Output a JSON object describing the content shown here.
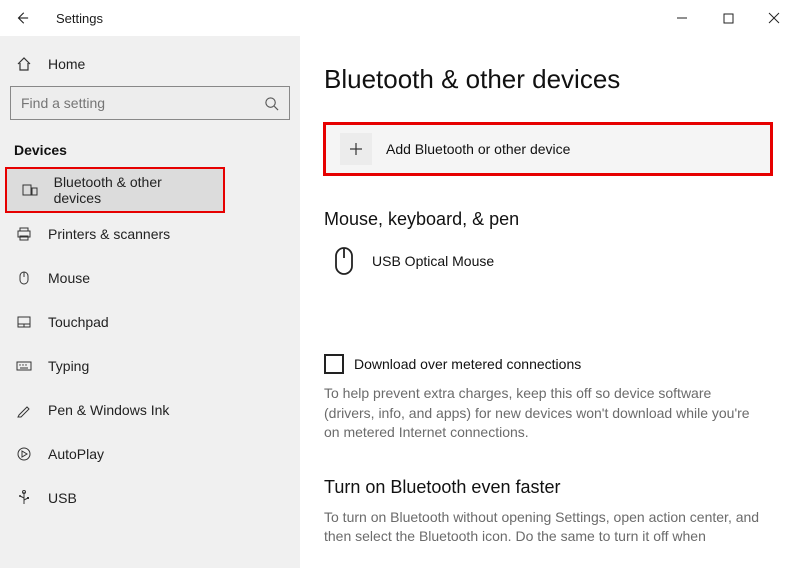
{
  "window": {
    "title": "Settings"
  },
  "sidebar": {
    "home_label": "Home",
    "search_placeholder": "Find a setting",
    "section_title": "Devices",
    "items": [
      {
        "label": "Bluetooth & other devices"
      },
      {
        "label": "Printers & scanners"
      },
      {
        "label": "Mouse"
      },
      {
        "label": "Touchpad"
      },
      {
        "label": "Typing"
      },
      {
        "label": "Pen & Windows Ink"
      },
      {
        "label": "AutoPlay"
      },
      {
        "label": "USB"
      }
    ]
  },
  "main": {
    "title": "Bluetooth & other devices",
    "add_device_label": "Add Bluetooth or other device",
    "section1_title": "Mouse, keyboard, & pen",
    "device1_label": "USB Optical Mouse",
    "metered_checkbox_label": "Download over metered connections",
    "metered_help": "To help prevent extra charges, keep this off so device software (drivers, info, and apps) for new devices won't download while you're on metered Internet connections.",
    "section2_title": "Turn on Bluetooth even faster",
    "section2_help": "To turn on Bluetooth without opening Settings, open action center, and then select the Bluetooth icon. Do the same to turn it off when"
  }
}
